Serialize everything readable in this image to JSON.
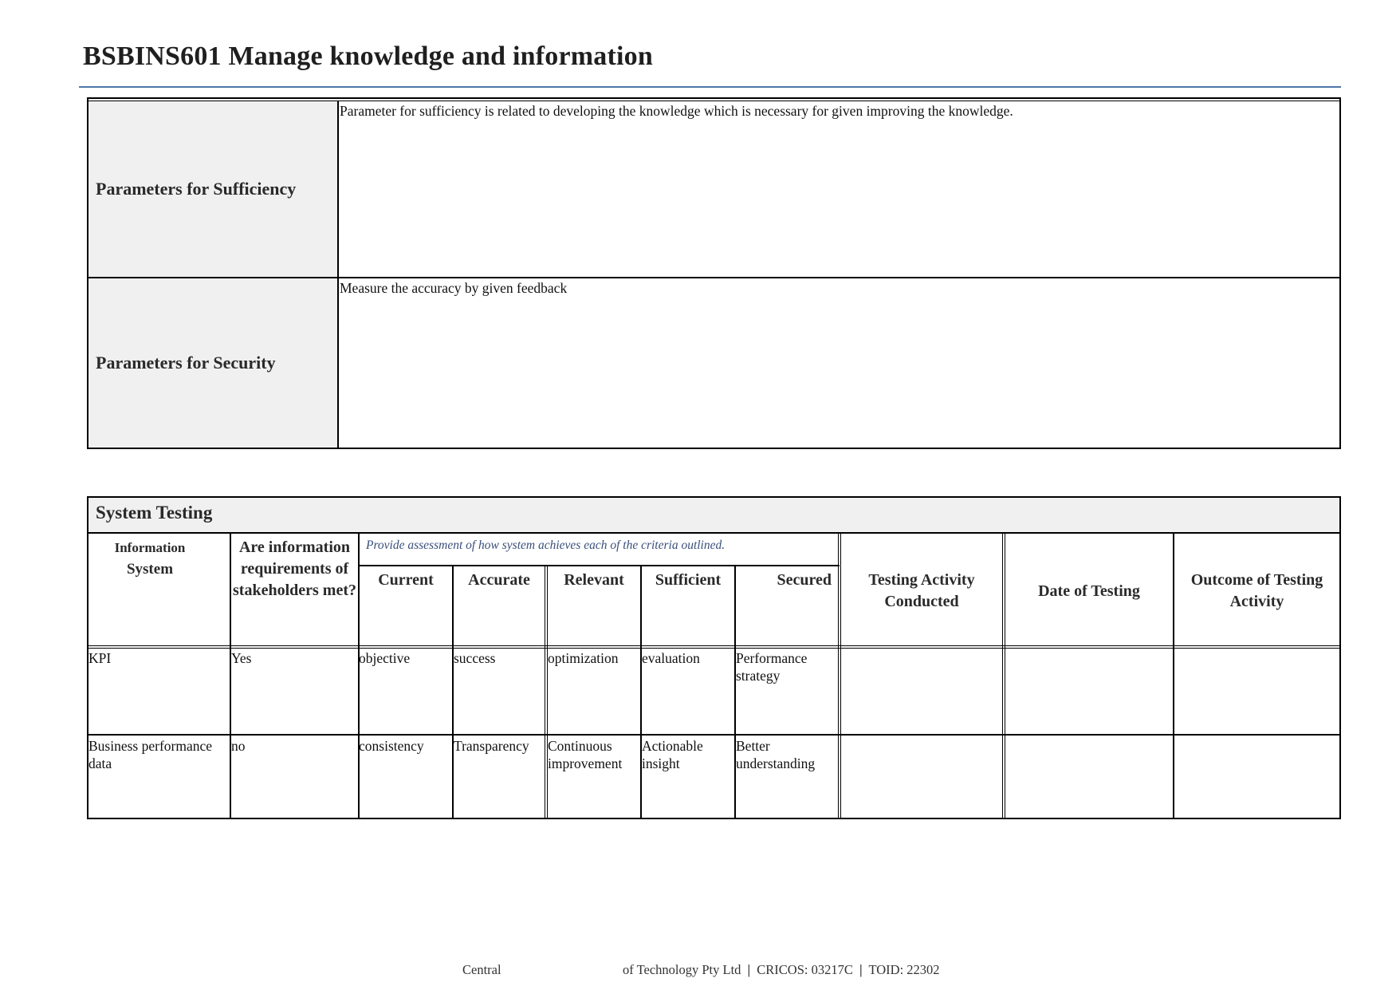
{
  "document": {
    "title": "BSBINS601 Manage knowledge and information",
    "accent_color": "#4f76a8",
    "label_bg_color": "#f0f0f0"
  },
  "parameters_table": {
    "rows": [
      {
        "label": "Parameters for Sufficiency",
        "value": "Parameter for sufficiency is related to developing the knowledge which is necessary for given improving the knowledge."
      },
      {
        "label": "Parameters for Security",
        "value": "Measure the accuracy by given feedback"
      }
    ]
  },
  "system_testing": {
    "title": "System Testing",
    "headers": {
      "information_system": "Information System",
      "info_sys_line1": "Information",
      "info_sys_line2": "System",
      "requirements_met": "Are information requirements of stakeholders met?",
      "criteria_instruction": "Provide assessment of how system achieves each of the criteria outlined.",
      "criteria": [
        "Current",
        "Accurate",
        "Relevant",
        "Sufficient",
        "Secured"
      ],
      "testing_activity": "Testing Activity Conducted",
      "date_of_testing": "Date of Testing",
      "outcome": "Outcome of Testing Activity"
    },
    "rows": [
      {
        "information_system": "KPI",
        "requirements_met": "Yes",
        "current": "objective",
        "accurate": "success",
        "relevant": "optimization",
        "sufficient": "evaluation",
        "secured": "Performance strategy",
        "testing_activity": "",
        "date_of_testing": "",
        "outcome": ""
      },
      {
        "information_system": "Business performance data",
        "requirements_met": "no",
        "current": "consistency",
        "accurate": "Transparency",
        "relevant": "Continuous improvement",
        "sufficient": "Actionable insight",
        "secured": "Better understanding",
        "testing_activity": "",
        "date_of_testing": "",
        "outcome": ""
      }
    ]
  },
  "footer": {
    "part1": "Central",
    "part2": "of Technology Pty Ltd",
    "separator": "|",
    "cricos": "CRICOS: 03217C",
    "toid": "TOID: 22302"
  }
}
